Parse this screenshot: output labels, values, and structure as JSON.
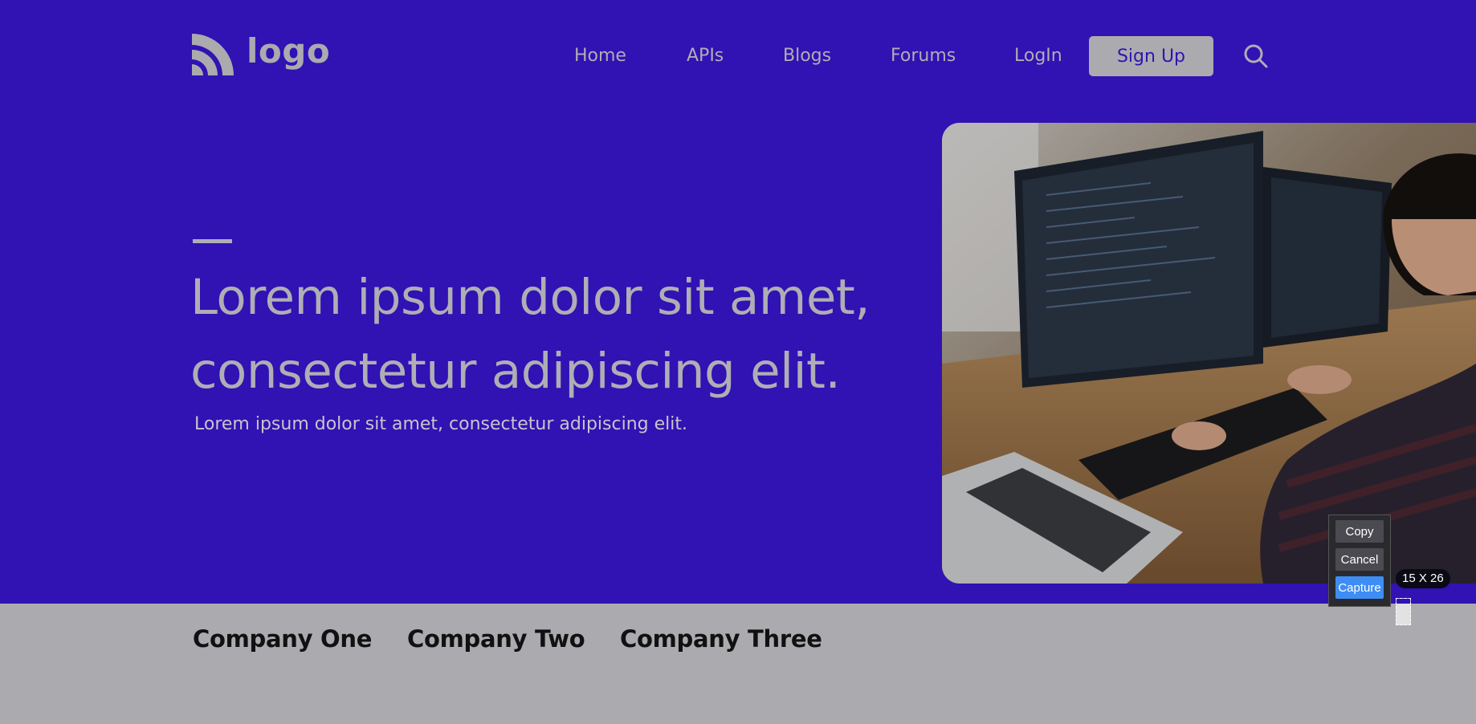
{
  "brand": {
    "logo_icon": "rss-icon",
    "logo_text": "logo"
  },
  "nav": {
    "items": [
      {
        "label": "Home"
      },
      {
        "label": "APIs"
      },
      {
        "label": "Blogs"
      },
      {
        "label": "Forums"
      },
      {
        "label": "LogIn"
      }
    ],
    "signup_label": "Sign Up",
    "search_icon": "search-icon"
  },
  "hero": {
    "title_line1": "Lorem ipsum dolor sit amet,",
    "title_line2": "consectetur adipiscing elit.",
    "subtitle": "Lorem ipsum dolor sit amet, consectetur adipiscing elit.",
    "image_subject": "developer-at-computer-image"
  },
  "companies": [
    {
      "name": "Company One"
    },
    {
      "name": "Company Two"
    },
    {
      "name": "Company Three"
    }
  ],
  "capture_tool": {
    "copy_label": "Copy",
    "cancel_label": "Cancel",
    "capture_label": "Capture",
    "size_label": "15 X 26"
  },
  "colors": {
    "primary": "#3112b3",
    "muted": "#ababaf",
    "capture_accent": "#3d8df5"
  }
}
